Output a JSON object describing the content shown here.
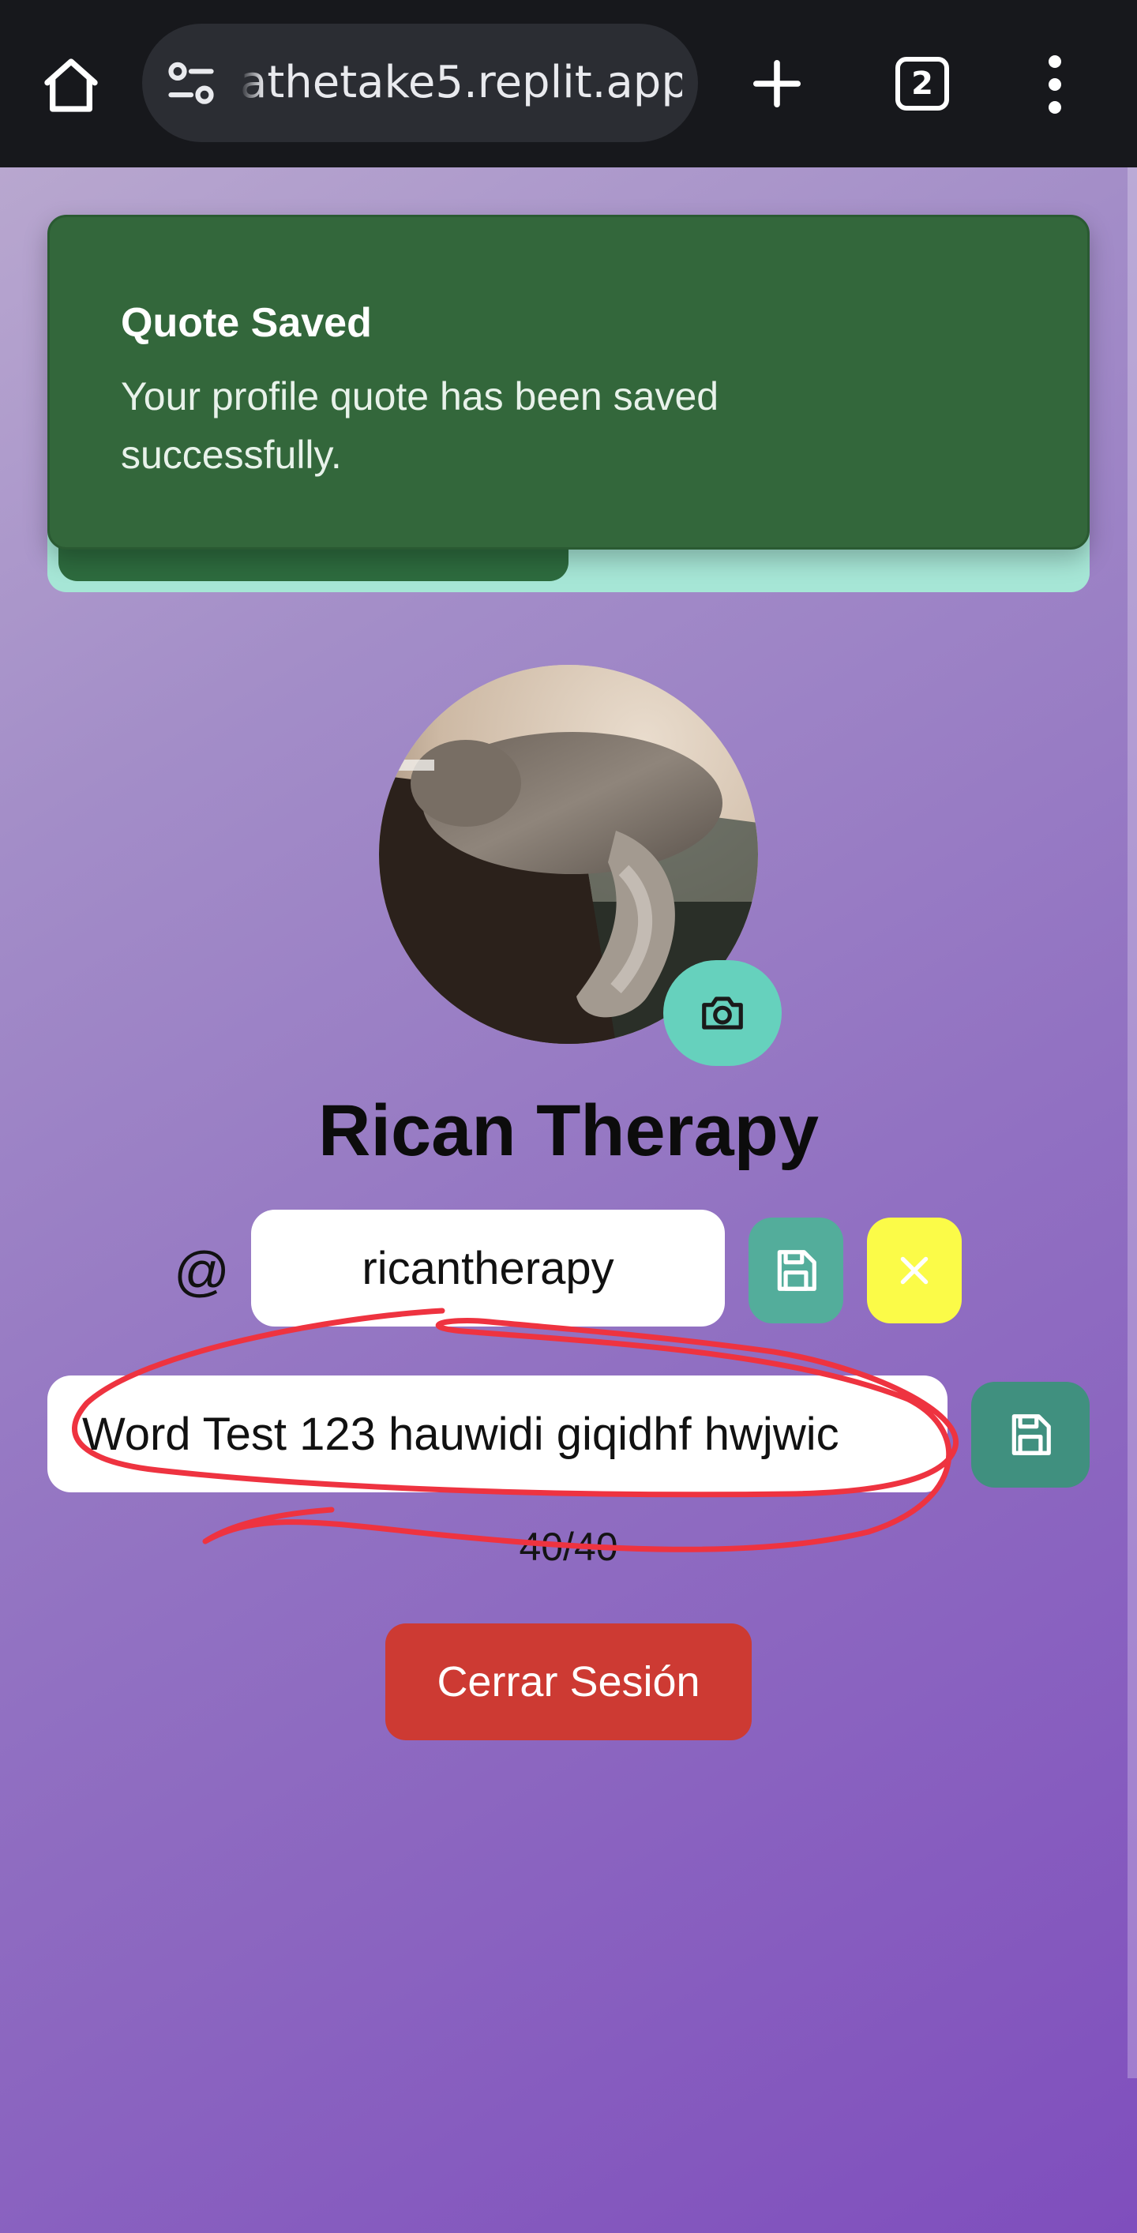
{
  "browser": {
    "url": "athetake5.replit.app",
    "tab_count": "2"
  },
  "toast": {
    "title": "Quote Saved",
    "message": "Your profile quote has been saved successfully."
  },
  "profile": {
    "display_name": "Rican Therapy",
    "at_sign": "@",
    "username": "ricantherapy",
    "quote": "Word Test 123 hauwidi giqidhf hwjwic",
    "char_count": "40/40",
    "logout_label": "Cerrar Sesión"
  },
  "colors": {
    "toast_bg": "#33673b",
    "accent_teal": "#66d1bd",
    "save_teal": "#53ad9b",
    "cancel_yellow": "#fbfb48",
    "logout_red": "#cd3a33",
    "annotation_red": "#ee3340"
  },
  "icons": {
    "home": "home-icon",
    "site_settings": "site-settings-icon",
    "new_tab": "plus-icon",
    "tab_switcher": "tab-switcher-icon",
    "menu": "more-vert-icon",
    "camera": "camera-icon",
    "save": "save-icon",
    "close": "close-icon"
  }
}
